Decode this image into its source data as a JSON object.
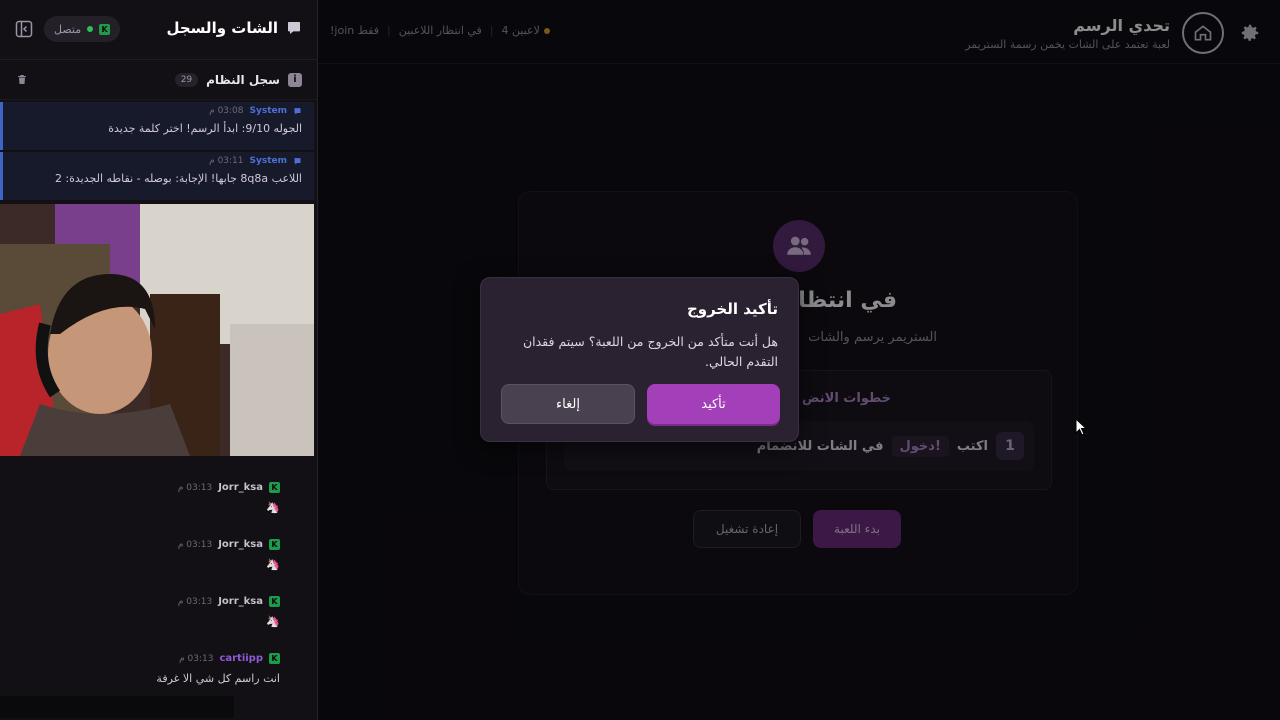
{
  "header": {
    "title": "تحدي الرسم",
    "subtitle": "لعبة تعتمد على الشات يخمن رسمة الستريمر",
    "status": {
      "players": "4 لاعبين",
      "state": "في انتظار اللاعبين",
      "mode": "!join فقط"
    }
  },
  "card": {
    "title": "في انتظا",
    "description": "الستريمر يرسم والشات",
    "steps_title": "خطوات الانض",
    "step": {
      "number": "1",
      "prefix": "اكتب",
      "command": "!دخول",
      "suffix": "في الشات للانضمام"
    },
    "restart_label": "إعادة تشغيل",
    "start_label": "بدء اللعبة"
  },
  "modal": {
    "title": "تأكيد الخروج",
    "message": "هل أنت متأكد من الخروج من اللعبة؟ سيتم فقدان التقدم الحالي.",
    "confirm_label": "تأكيد",
    "cancel_label": "إلغاء"
  },
  "sidebar": {
    "title": "الشات والسجل",
    "online_label": "متصل",
    "syslog_title": "سجل النظام",
    "syslog_count": "29",
    "system_messages": [
      {
        "name": "System",
        "time": "03:08 م",
        "text": "الجوله 9/10: ابدأ الرسم! اختر كلمة جديدة"
      },
      {
        "name": "System",
        "time": "03:11 م",
        "text": "اللاعب 8q8a جابها! الإجابة: بوصله - نقاطه الجديدة: 2"
      }
    ],
    "chat_messages": [
      {
        "user": "Jorr_ksa",
        "time": "03:13 م",
        "text": "🦄"
      },
      {
        "user": "Jorr_ksa",
        "time": "03:13 م",
        "text": "🦄"
      },
      {
        "user": "Jorr_ksa",
        "time": "03:13 م",
        "text": "🦄"
      },
      {
        "user": "cartiipp",
        "time": "03:13 م",
        "text": "انت راسم كل شي الا غرفة"
      }
    ]
  },
  "colors": {
    "accent": "#a33fb8",
    "system_blue": "#3e64c8",
    "online_green": "#2fbf5a"
  }
}
